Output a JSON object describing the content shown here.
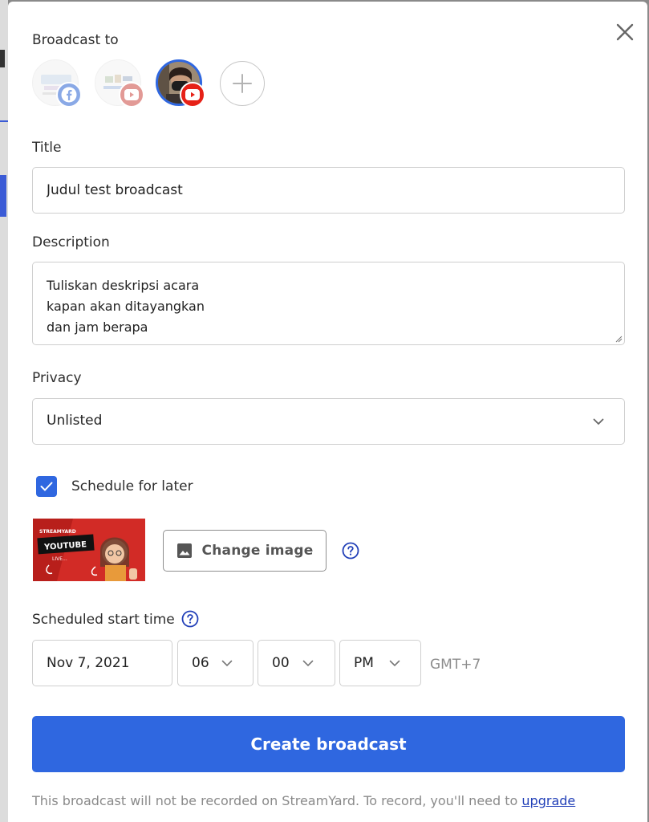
{
  "modal": {
    "broadcast_to_label": "Broadcast to",
    "title_label": "Title",
    "title_value": "Judul test broadcast",
    "description_label": "Description",
    "description_value": "Tuliskan deskripsi acara\nkapan akan ditayangkan\ndan jam berapa",
    "privacy_label": "Privacy",
    "privacy_value": "Unlisted",
    "schedule_label": "Schedule for later",
    "schedule_checked": true,
    "change_image_label": "Change image",
    "scheduled_start_label": "Scheduled start time",
    "date_value": "Nov 7, 2021",
    "hour_value": "06",
    "minute_value": "00",
    "ampm_value": "PM",
    "timezone": "GMT+7",
    "create_button": "Create broadcast",
    "footer_text": "This broadcast will not be recorded on StreamYard. To record, you'll need to ",
    "footer_link": "upgrade"
  },
  "destinations": [
    {
      "platform": "facebook",
      "icon": "facebook-icon",
      "selected": false
    },
    {
      "platform": "youtube",
      "icon": "youtube-icon",
      "selected": false
    },
    {
      "platform": "youtube",
      "icon": "youtube-icon",
      "selected": true
    }
  ],
  "thumbnail_text": {
    "brand": "STREAMYARD",
    "headline": "YOUTUBE",
    "sub": "LIVE..."
  },
  "colors": {
    "accent": "#2f67e0",
    "facebook": "#1877f2",
    "youtube": "#e62117",
    "thumbnail_bg": "#d22b26"
  }
}
